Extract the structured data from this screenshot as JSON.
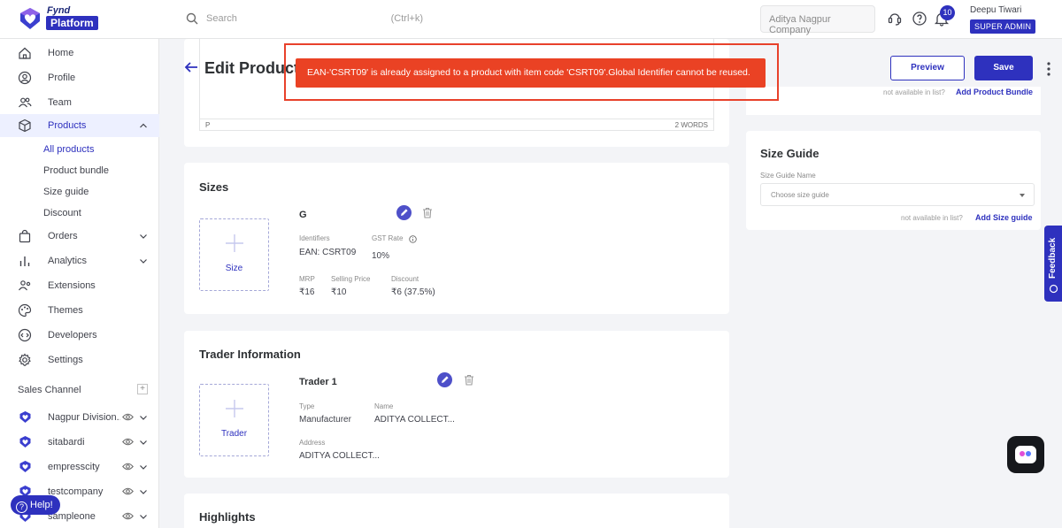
{
  "brand": {
    "line1": "Fynd",
    "line2": "Platform"
  },
  "search": {
    "placeholder": "Search",
    "shortcut": "(Ctrl+k)"
  },
  "company_selector": "Aditya Nagpur Company",
  "notifications": {
    "count": "10"
  },
  "user": {
    "name": "Deepu Tiwari",
    "role": "SUPER ADMIN"
  },
  "sidebar": {
    "items": [
      {
        "label": "Home"
      },
      {
        "label": "Profile"
      },
      {
        "label": "Team"
      },
      {
        "label": "Products"
      },
      {
        "label": "Orders"
      },
      {
        "label": "Analytics"
      },
      {
        "label": "Extensions"
      },
      {
        "label": "Themes"
      },
      {
        "label": "Developers"
      },
      {
        "label": "Settings"
      }
    ],
    "products_sub": [
      "All products",
      "Product bundle",
      "Size guide",
      "Discount"
    ],
    "sales_channel_title": "Sales Channel",
    "sales_channel_add": "+",
    "channels": [
      "Nagpur Division...",
      "sitabardi",
      "empresscity",
      "testcompany",
      "sampleone"
    ],
    "help_label": "Help!"
  },
  "header": {
    "title": "Edit Product",
    "preview_label": "Preview",
    "save_label": "Save"
  },
  "toast": {
    "message": "EAN-'CSRT09' is already assigned to a product with item code 'CSRT09'.Global Identifier cannot be reused.",
    "color": "#ea4224"
  },
  "editor": {
    "status_tag": "P",
    "word_count": "2 WORDS"
  },
  "sizes": {
    "title": "Sizes",
    "add_label": "Size",
    "item": {
      "name": "G",
      "identifiers_label": "Identifiers",
      "identifiers_value": "EAN: CSRT09",
      "gst_label": "GST Rate",
      "gst_value": "10%",
      "mrp_label": "MRP",
      "mrp_value": "₹16",
      "selling_label": "Selling Price",
      "selling_value": "₹10",
      "discount_label": "Discount",
      "discount_value": "₹6 (37.5%)"
    }
  },
  "trader": {
    "title": "Trader Information",
    "add_label": "Trader",
    "item": {
      "name": "Trader 1",
      "type_label": "Type",
      "type_value": "Manufacturer",
      "name_label": "Name",
      "name_value": "ADITYA COLLECT...",
      "address_label": "Address",
      "address_value": "ADITYA COLLECT..."
    }
  },
  "highlights": {
    "title": "Highlights"
  },
  "bundle": {
    "not_available": "not available in list?",
    "link": "Add Product Bundle"
  },
  "size_guide": {
    "title": "Size Guide",
    "field_label": "Size Guide Name",
    "placeholder": "Choose size guide",
    "not_available": "not available in list?",
    "link": "Add Size guide"
  },
  "feedback_label": "Feedback",
  "accent_color": "#2e31be"
}
